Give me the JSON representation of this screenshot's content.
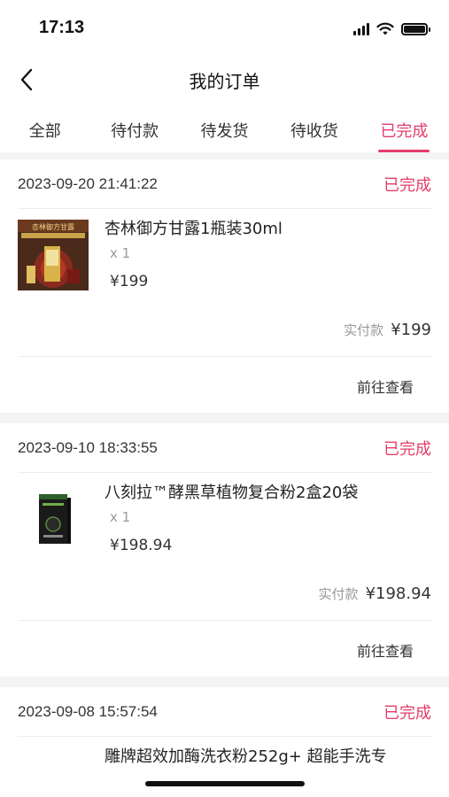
{
  "status_bar": {
    "time": "17:13"
  },
  "header": {
    "title": "我的订单"
  },
  "tabs": [
    {
      "label": "全部",
      "active": false
    },
    {
      "label": "待付款",
      "active": false
    },
    {
      "label": "待发货",
      "active": false
    },
    {
      "label": "待收货",
      "active": false
    },
    {
      "label": "已完成",
      "active": true
    }
  ],
  "orders": [
    {
      "time": "2023-09-20 21:41:22",
      "status": "已完成",
      "product_name": "杏林御方甘露1瓶装30ml",
      "quantity": "x 1",
      "price": "¥199",
      "paid_label": "实付款",
      "paid_amount": "¥199",
      "action": "前往查看",
      "thumb_text": "杏林御方甘露"
    },
    {
      "time": "2023-09-10 18:33:55",
      "status": "已完成",
      "product_name": "八刻拉™酵黑草植物复合粉2盒20袋",
      "quantity": "x 1",
      "price": "¥198.94",
      "paid_label": "实付款",
      "paid_amount": "¥198.94",
      "action": "前往查看"
    },
    {
      "time": "2023-09-08 15:57:54",
      "status": "已完成",
      "product_name": "雕牌超效加酶洗衣粉252g+ 超能手洗专"
    }
  ],
  "colors": {
    "accent": "#e33d6d",
    "background": "#f4f4f4"
  }
}
